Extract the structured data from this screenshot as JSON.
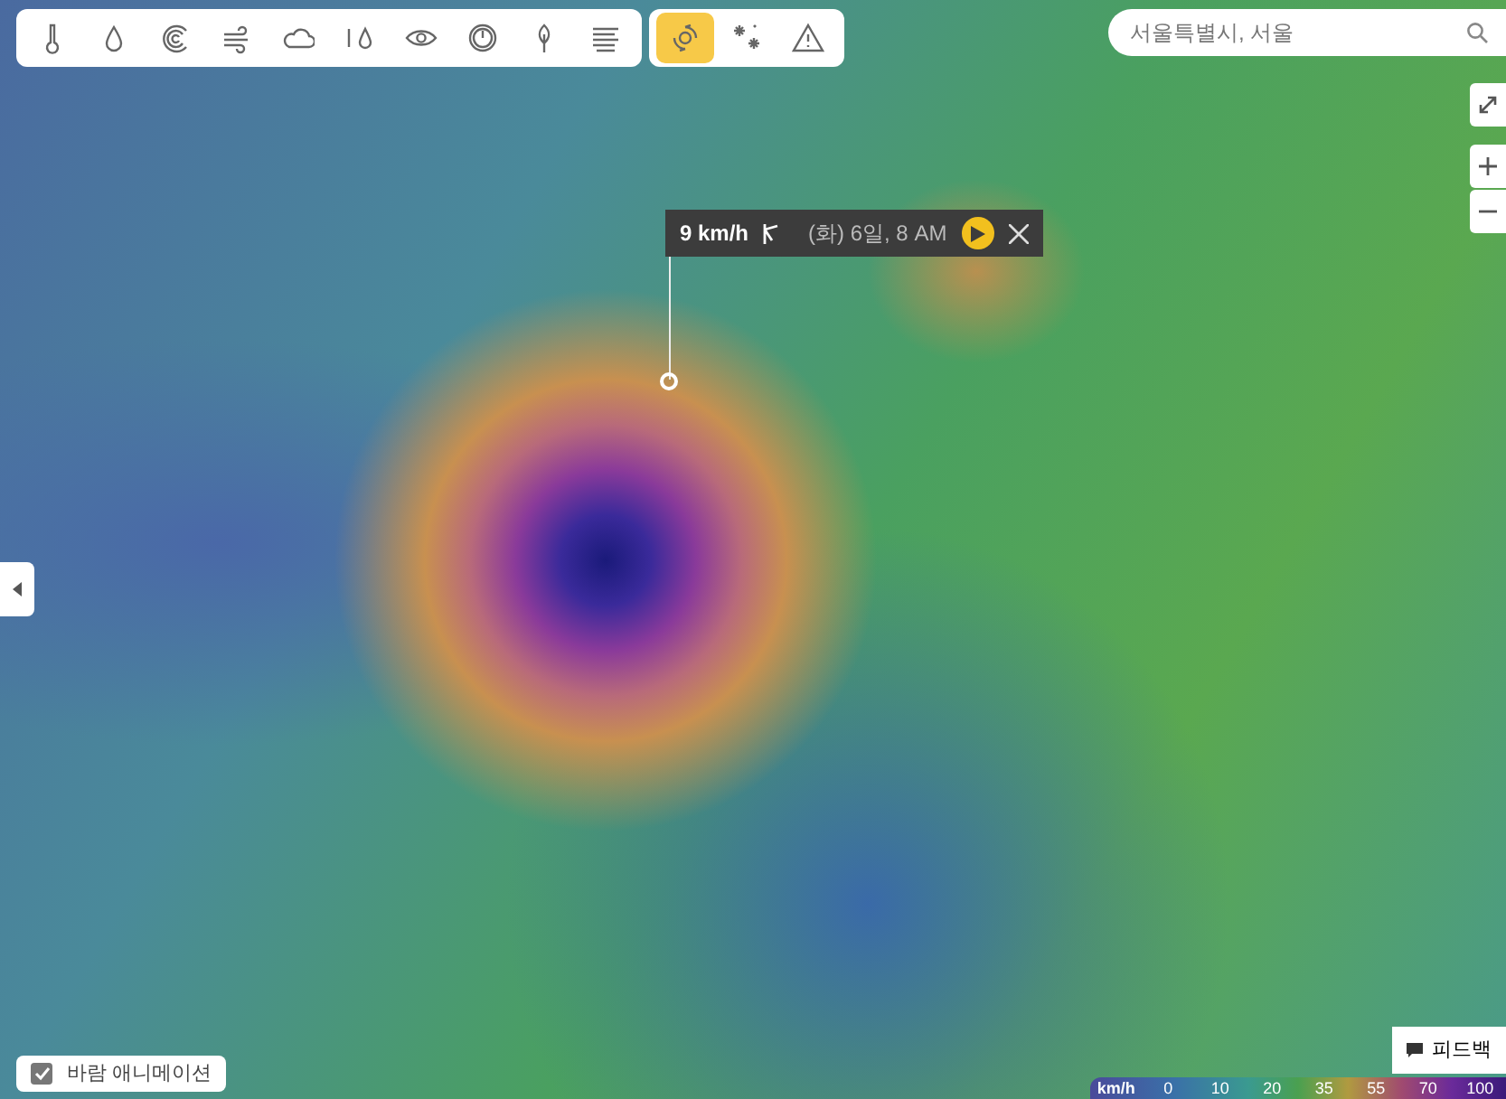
{
  "toolbar": {
    "layers": [
      {
        "kind": "thermometer",
        "selected": false
      },
      {
        "kind": "drop",
        "selected": false
      },
      {
        "kind": "rings",
        "selected": false
      },
      {
        "kind": "wind",
        "selected": false
      },
      {
        "kind": "cloud",
        "selected": false
      },
      {
        "kind": "drops",
        "selected": false
      },
      {
        "kind": "eye",
        "selected": false
      },
      {
        "kind": "gauge",
        "selected": false
      },
      {
        "kind": "tree",
        "selected": false
      },
      {
        "kind": "fog",
        "selected": false
      }
    ],
    "overlays": [
      {
        "kind": "hurricane",
        "selected": true
      },
      {
        "kind": "snow",
        "selected": false
      },
      {
        "kind": "warning",
        "selected": false
      }
    ]
  },
  "search": {
    "placeholder": "서울특별시, 서울"
  },
  "popup": {
    "speed": "9 km/h",
    "time": "(화) 6일, 8 AM"
  },
  "animation": {
    "label": "바람 애니메이션",
    "checked": true
  },
  "feedback": {
    "label": "피드백"
  },
  "legend": {
    "unit": "km/h",
    "ticks": [
      "0",
      "10",
      "20",
      "35",
      "55",
      "70",
      "100"
    ]
  }
}
